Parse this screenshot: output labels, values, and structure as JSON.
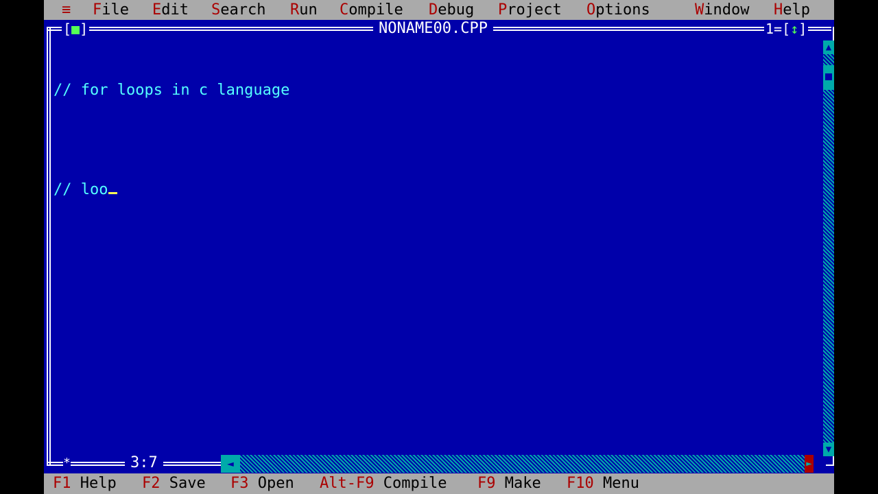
{
  "menu": {
    "system": "≡",
    "items": [
      {
        "hot": "F",
        "rest": "ile"
      },
      {
        "hot": "E",
        "rest": "dit"
      },
      {
        "hot": "S",
        "rest": "earch"
      },
      {
        "hot": "R",
        "rest": "un"
      },
      {
        "hot": "C",
        "rest": "ompile"
      },
      {
        "hot": "D",
        "rest": "ebug"
      },
      {
        "hot": "P",
        "rest": "roject"
      },
      {
        "hot": "O",
        "rest": "ptions"
      },
      {
        "hot": "W",
        "rest": "indow"
      },
      {
        "hot": "H",
        "rest": "elp"
      }
    ]
  },
  "window": {
    "close_left": "[",
    "close_mark": "■",
    "close_right": "]",
    "title": "NONAME00.CPP",
    "number": "1=",
    "zoom_left": "[",
    "zoom_mark": "↕",
    "zoom_right": "]",
    "cursor_pos": "3:7",
    "modified_mark": "*"
  },
  "editor": {
    "lines": [
      "// for loops in c language",
      "",
      "// loo"
    ]
  },
  "scroll": {
    "up": "▲",
    "down": "▼",
    "left": "◄",
    "right": "►"
  },
  "status": {
    "keys": [
      {
        "key": "F1",
        "label": " Help"
      },
      {
        "key": "F2",
        "label": " Save"
      },
      {
        "key": "F3",
        "label": " Open"
      },
      {
        "key": "Alt-F9",
        "label": " Compile"
      },
      {
        "key": "F9",
        "label": " Make"
      },
      {
        "key": "F10",
        "label": " Menu"
      }
    ]
  },
  "colors": {
    "background": "#0000AA",
    "menu_bg": "#AAAAAA",
    "hotkey": "#AA0000",
    "comment_text": "#55FFFF",
    "cursor": "#FFFF55"
  }
}
